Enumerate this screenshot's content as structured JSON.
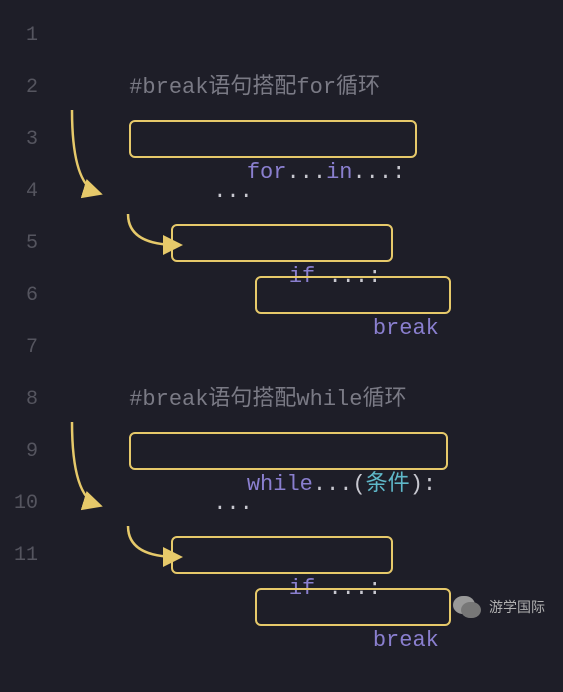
{
  "gutter": [
    "1",
    "2",
    "3",
    "4",
    "5",
    "6",
    "7",
    "8",
    "9",
    "10",
    "11"
  ],
  "lines": {
    "l1_comment": "#break语句搭配for循环",
    "l2_for": "for",
    "l2_in": "in",
    "l2_dots1": "...",
    "l2_dots2": "...",
    "l2_colon": ":",
    "l3_dots": "...",
    "l4_if": "if",
    "l4_dots": " ...",
    "l4_colon": ":",
    "l5_break": "break",
    "l7_comment": "#break语句搭配while循环",
    "l8_while": "while",
    "l8_dots": "...",
    "l8_paren_open": "(",
    "l8_cond": "条件",
    "l8_paren_close": ")",
    "l8_colon": ":",
    "l9_dots": "...",
    "l10_if": "if",
    "l10_dots": " ...",
    "l10_colon": ":",
    "l11_break": "break"
  },
  "watermark": {
    "text": "游学国际"
  },
  "colors": {
    "box_border": "#e6c96a",
    "arrow": "#e6c96a",
    "keyword": "#8a7fcf",
    "comment": "#7a7a85",
    "condition": "#5fb8c9"
  }
}
